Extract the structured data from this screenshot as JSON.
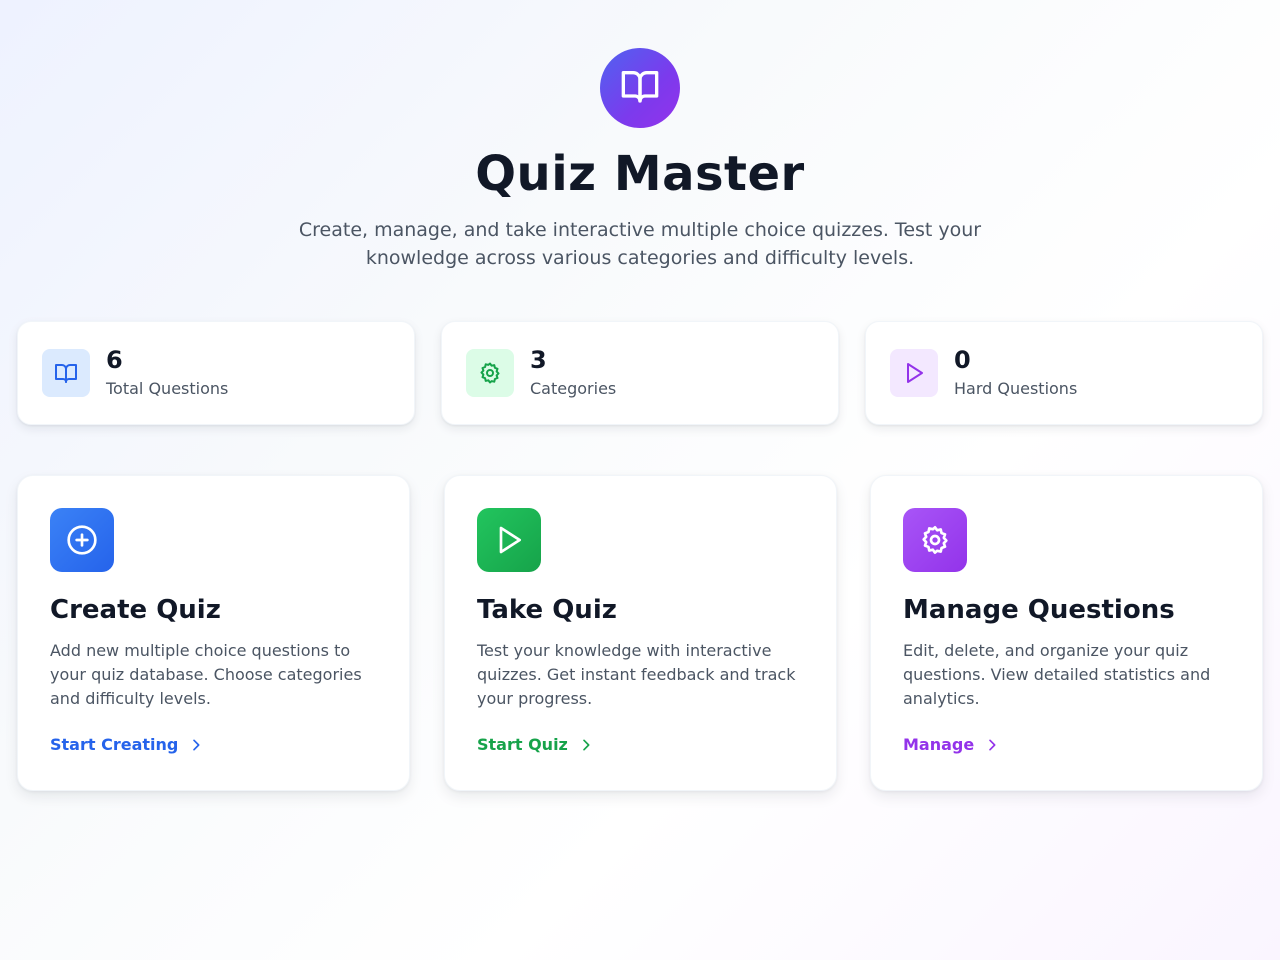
{
  "hero": {
    "logo_icon": "book-open-icon",
    "title": "Quiz Master",
    "subtitle": "Create, manage, and take interactive multiple choice quizzes. Test your knowledge across various categories and difficulty levels."
  },
  "stats": [
    {
      "icon": "book-open-icon",
      "value": "6",
      "label": "Total Questions",
      "color": "#2563eb",
      "bg": "#dbeafe"
    },
    {
      "icon": "gear-icon",
      "value": "3",
      "label": "Categories",
      "color": "#16a34a",
      "bg": "#dcfce7"
    },
    {
      "icon": "play-icon",
      "value": "0",
      "label": "Hard Questions",
      "color": "#9333ea",
      "bg": "#f3e8ff"
    }
  ],
  "features": [
    {
      "icon": "plus-circle-icon",
      "title": "Create Quiz",
      "description": "Add new multiple choice questions to your quiz database. Choose categories and difficulty levels.",
      "link": "Start Creating",
      "color": "#2563eb"
    },
    {
      "icon": "play-icon",
      "title": "Take Quiz",
      "description": "Test your knowledge with interactive quizzes. Get instant feedback and track your progress.",
      "link": "Start Quiz",
      "color": "#16a34a"
    },
    {
      "icon": "gear-icon",
      "title": "Manage Questions",
      "description": "Edit, delete, and organize your quiz questions. View detailed statistics and analytics.",
      "link": "Manage",
      "color": "#9333ea"
    }
  ]
}
